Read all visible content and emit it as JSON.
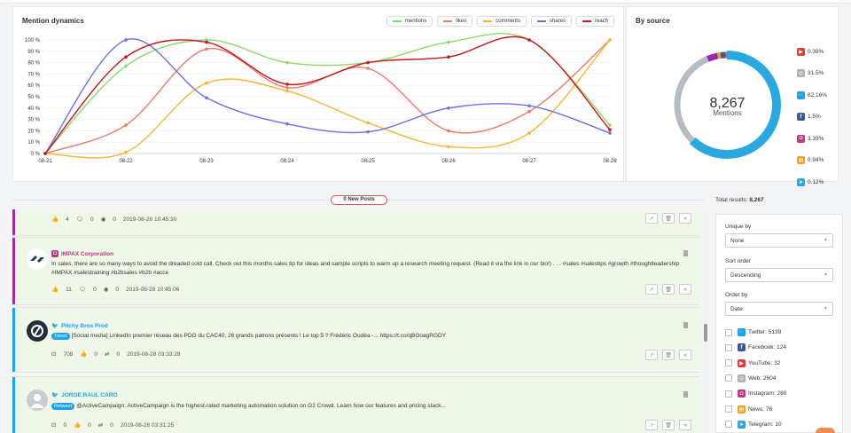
{
  "dynamics": {
    "title": "Mention dynamics",
    "legend": [
      {
        "name": "mentions",
        "color": "#8fd96b"
      },
      {
        "name": "likes",
        "color": "#f07a6a"
      },
      {
        "name": "comments",
        "color": "#f5b731"
      },
      {
        "name": "shares",
        "color": "#6f6ee6"
      },
      {
        "name": "reach",
        "color": "#c2181c"
      }
    ]
  },
  "chart_data": {
    "type": "line",
    "x": [
      "08-21",
      "08-22",
      "08-23",
      "08-24",
      "08-25",
      "08-26",
      "08-27",
      "08-28"
    ],
    "yticks": [
      "0 %",
      "10 %",
      "20 %",
      "30 %",
      "40 %",
      "50 %",
      "60 %",
      "70 %",
      "80 %",
      "90 %",
      "100 %"
    ],
    "ylim": [
      0,
      100
    ],
    "series": [
      {
        "name": "mentions",
        "color": "#8fd96b",
        "values": [
          0,
          77,
          100,
          80,
          80,
          98,
          100,
          25
        ]
      },
      {
        "name": "likes",
        "color": "#f07a6a",
        "values": [
          0,
          25,
          92,
          58,
          75,
          20,
          37,
          100
        ]
      },
      {
        "name": "comments",
        "color": "#f5b731",
        "values": [
          0,
          1,
          62,
          55,
          27,
          6,
          18,
          100
        ]
      },
      {
        "name": "shares",
        "color": "#6f6ee6",
        "values": [
          0,
          100,
          49,
          26,
          19,
          40,
          42,
          18
        ]
      },
      {
        "name": "reach",
        "color": "#c2181c",
        "values": [
          0,
          85,
          98,
          61,
          80,
          85,
          100,
          21
        ]
      }
    ]
  },
  "by_source": {
    "title": "By source",
    "total": "8,267",
    "total_label": "Mentions",
    "donut": [
      {
        "name": "twitter",
        "pct": 62.16,
        "color": "#2aa9e0"
      },
      {
        "name": "web",
        "pct": 31.5,
        "color": "#b6bcc4"
      },
      {
        "name": "instagram",
        "pct": 3.39,
        "color": "#9c27b0"
      },
      {
        "name": "news",
        "pct": 0.94,
        "color": "#f0a020"
      },
      {
        "name": "facebook",
        "pct": 1.5,
        "color": "#3b5998"
      },
      {
        "name": "youtube",
        "pct": 0.39,
        "color": "#e53935"
      },
      {
        "name": "telegram",
        "pct": 0.12,
        "color": "#2ca5e0"
      }
    ],
    "list": [
      {
        "icon": "youtube-icon",
        "color": "#e53935",
        "glyph": "▶",
        "value": "0.39%"
      },
      {
        "icon": "web-icon",
        "color": "#b0b0b0",
        "glyph": "◎",
        "value": "31.5%"
      },
      {
        "icon": "twitter-icon",
        "color": "#1da1f2",
        "glyph": "🐦",
        "value": "62.16%"
      },
      {
        "icon": "facebook-icon",
        "color": "#3b5998",
        "glyph": "f",
        "value": "1.5%"
      },
      {
        "icon": "instagram-icon",
        "color": "#c13584",
        "glyph": "◘",
        "value": "3.39%"
      },
      {
        "icon": "news-icon",
        "color": "#f0a020",
        "glyph": "▤",
        "value": "0.94%"
      },
      {
        "icon": "telegram-icon",
        "color": "#2ca5e0",
        "glyph": "➤",
        "value": "0.12%"
      }
    ]
  },
  "new_posts": "0 New Posts",
  "total_results": {
    "label": "Total results:",
    "value": "8,267"
  },
  "posts": [
    {
      "likes": "4",
      "comments": "0",
      "views": "0",
      "time": "2019-08-28 10:45:30"
    },
    {
      "author": "IMPAX Corporation",
      "text": "In sales, there are so many ways to avoid the dreaded cold call. Check out this months sales tip for ideas and sample scripts to warm up a research meeting request.   (Read it via the link in our bio!)   .  .  .  #sales #salestips #growth #thoughtleadership #IMPAX #salestraining #b2bsales #b2b #acce",
      "likes": "11",
      "comments": "0",
      "views": "0",
      "time": "2019-08-28 10:45:06"
    },
    {
      "author": "Pitchy Bros Prod",
      "tag": "Tweet",
      "text": "[Social media] LinkedIn premier réseau des PDG du CAC40, 26 grands patrons présents ! Le top 5 ? Frédéric Oudéa -... https://t.co/qBGoagRGDY",
      "reach": "708",
      "likes": "0",
      "retweets": "0",
      "time": "2019-08-28 03:33:28"
    },
    {
      "author": "JORGE RAUL CARO",
      "tag": "Retweet",
      "text": "@ActiveCampaign: ActiveCampaign is the highest-rated marketing automation solution on G2 Crowd. Learn how our features and pricing stack...",
      "reach": "0",
      "likes": "0",
      "retweets": "0",
      "time": "2019-08-28 03:31:25"
    }
  ],
  "filters": {
    "unique_label": "Unique by",
    "unique_value": "None",
    "sort_label": "Sort order",
    "sort_value": "Descending",
    "order_label": "Order by",
    "order_value": "Date",
    "sources": [
      {
        "icon": "twitter-icon",
        "color": "#1da1f2",
        "glyph": "🐦",
        "label": "Twitter: 5139"
      },
      {
        "icon": "facebook-icon",
        "color": "#3b5998",
        "glyph": "f",
        "label": "Facebook: 124"
      },
      {
        "icon": "youtube-icon",
        "color": "#e53935",
        "glyph": "▶",
        "label": "YouTube: 32"
      },
      {
        "icon": "web-icon",
        "color": "#b0b0b0",
        "glyph": "◎",
        "label": "Web: 2604"
      },
      {
        "icon": "instagram-icon",
        "color": "#c13584",
        "glyph": "◘",
        "label": "Instagram: 280"
      },
      {
        "icon": "news-icon",
        "color": "#f0a020",
        "glyph": "▤",
        "label": "News: 78"
      },
      {
        "icon": "telegram-icon",
        "color": "#2ca5e0",
        "glyph": "➤",
        "label": "Telegram: 10"
      }
    ]
  }
}
